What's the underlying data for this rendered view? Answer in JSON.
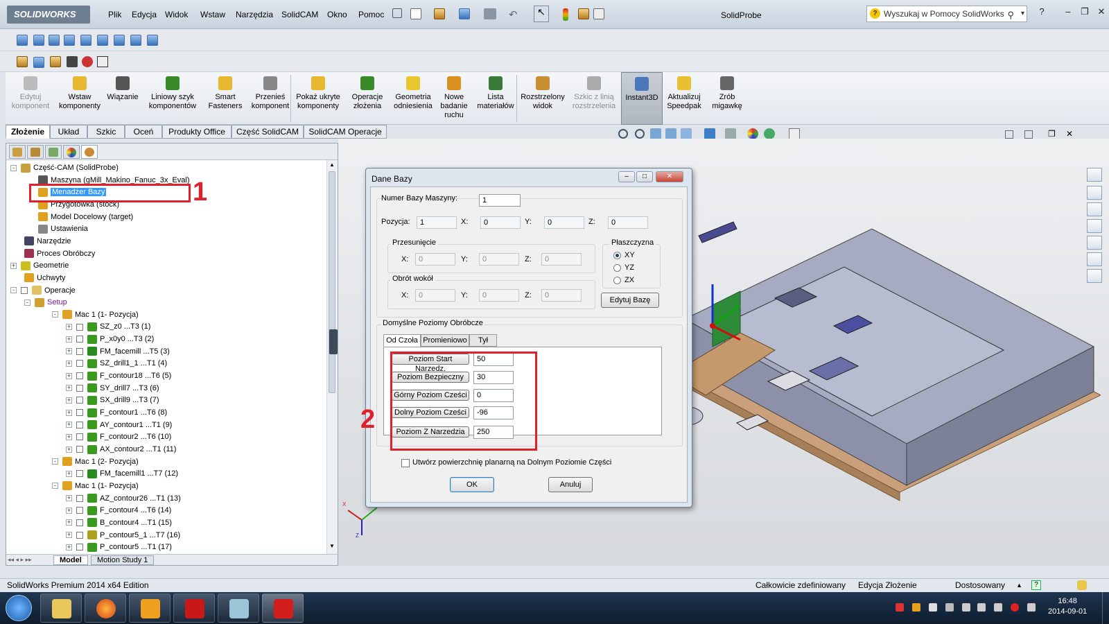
{
  "app": {
    "logo": "SOLIDWORKS",
    "title": "SolidProbe",
    "menu": [
      "Plik",
      "Edycja",
      "Widok",
      "Wstaw",
      "Narzędzia",
      "SolidCAM",
      "Okno",
      "Pomoc"
    ],
    "help_search_placeholder": "Wyszukaj w Pomocy SolidWorks",
    "help_btn": "?"
  },
  "command_manager": [
    {
      "label": "Edytuj komponent",
      "disabled": true,
      "icon": "edit-component-icon"
    },
    {
      "label": "Wstaw komponenty",
      "disabled": false,
      "icon": "insert-components-icon"
    },
    {
      "label": "Wiązanie",
      "disabled": false,
      "icon": "mate-icon"
    },
    {
      "label": "Liniowy szyk komponentów",
      "disabled": false,
      "icon": "linear-pattern-icon"
    },
    {
      "label": "Smart Fasteners",
      "disabled": false,
      "icon": "smart-fasteners-icon"
    },
    {
      "label": "Przenieś komponent",
      "disabled": false,
      "icon": "move-component-icon"
    },
    {
      "label": "Pokaż ukryte komponenty",
      "disabled": false,
      "icon": "show-hidden-icon"
    },
    {
      "label": "Operacje złożenia",
      "disabled": false,
      "icon": "assembly-features-icon"
    },
    {
      "label": "Geometria odniesienia",
      "disabled": false,
      "icon": "reference-geometry-icon"
    },
    {
      "label": "Nowe badanie ruchu",
      "disabled": false,
      "icon": "motion-study-icon"
    },
    {
      "label": "Lista materiałów",
      "disabled": false,
      "icon": "bom-icon"
    },
    {
      "label": "Rozstrzelony widok",
      "disabled": false,
      "icon": "exploded-view-icon"
    },
    {
      "label": "Szkic z linią rozstrzelenia",
      "disabled": true,
      "icon": "explode-line-icon"
    },
    {
      "label": "Instant3D",
      "disabled": false,
      "selected": true,
      "icon": "instant3d-icon"
    },
    {
      "label": "Aktualizuj Speedpak",
      "disabled": false,
      "icon": "speedpak-icon"
    },
    {
      "label": "Zrób migawkę",
      "disabled": false,
      "icon": "snapshot-icon"
    }
  ],
  "tabs": [
    "Złożenie",
    "Układ",
    "Szkic",
    "Oceń",
    "Produkty Office",
    "Część SolidCAM",
    "SolidCAM Operacje"
  ],
  "tree": [
    {
      "text": "Część-CAM (SolidProbe)",
      "level": 0,
      "pm": "-",
      "icon": "cam-part-icon",
      "color": "#c9a040"
    },
    {
      "text": "Maszyna (gMill_Makino_Fanuc_3x_Eval)",
      "level": 2,
      "icon": "machine-icon",
      "color": "#555"
    },
    {
      "text": "Menadżer Bazy",
      "level": 2,
      "icon": "coordinate-manager-icon",
      "color": "#e0a020",
      "highlight": true
    },
    {
      "text": "Przygotówka (stock)",
      "level": 2,
      "icon": "stock-icon",
      "color": "#e0a020"
    },
    {
      "text": "Model Docelowy (target)",
      "level": 2,
      "icon": "target-icon",
      "color": "#e0a020"
    },
    {
      "text": "Ustawienia",
      "level": 2,
      "icon": "settings-icon",
      "color": "#888"
    },
    {
      "text": "Narzędzie",
      "level": 1,
      "icon": "tool-icon",
      "color": "#446"
    },
    {
      "text": "Proces Obróbczy",
      "level": 1,
      "icon": "process-icon",
      "color": "#a03050"
    },
    {
      "text": "Geometrie",
      "level": 0,
      "pm": "+",
      "icon": "geometry-icon",
      "color": "#c9c020"
    },
    {
      "text": "Uchwyty",
      "level": 1,
      "icon": "fixture-icon",
      "color": "#e0a020"
    },
    {
      "text": "Operacje",
      "level": 0,
      "pm": "-",
      "cb": true,
      "icon": "operations-folder-icon",
      "color": "#e0c060"
    },
    {
      "text": "Setup",
      "level": 1,
      "pm": "-",
      "icon": "setup-icon",
      "color": "#d0a030",
      "purple": true
    },
    {
      "text": "Mac 1 (1- Pozycja)",
      "level": 3,
      "pm": "-",
      "icon": "mac-icon",
      "color": "#e0a020"
    },
    {
      "text": "SZ_z0 ...T3 (1)",
      "level": 4,
      "pm": "+",
      "cb": true,
      "icon": "operation-icon",
      "color": "#3a9a20"
    },
    {
      "text": "P_x0y0 ...T3 (2)",
      "level": 4,
      "pm": "+",
      "cb": true,
      "icon": "operation-icon",
      "color": "#3a9a20"
    },
    {
      "text": "FM_facemill ...T5 (3)",
      "level": 4,
      "pm": "+",
      "cb": true,
      "icon": "facemill-icon",
      "color": "#2a8a20"
    },
    {
      "text": "SZ_drill1_1 ...T1 (4)",
      "level": 4,
      "pm": "+",
      "cb": true,
      "icon": "operation-icon",
      "color": "#3a9a20"
    },
    {
      "text": "F_contour18 ...T6 (5)",
      "level": 4,
      "pm": "+",
      "cb": true,
      "icon": "contour-icon",
      "color": "#3a9a20"
    },
    {
      "text": "SY_drill7 ...T3 (6)",
      "level": 4,
      "pm": "+",
      "cb": true,
      "icon": "operation-icon",
      "color": "#3a9a20"
    },
    {
      "text": "SX_drill9 ...T3 (7)",
      "level": 4,
      "pm": "+",
      "cb": true,
      "icon": "operation-icon",
      "color": "#3a9a20"
    },
    {
      "text": "F_contour1 ...T6 (8)",
      "level": 4,
      "pm": "+",
      "cb": true,
      "icon": "contour-icon",
      "color": "#3a9a20"
    },
    {
      "text": "AY_contour1 ...T1 (9)",
      "level": 4,
      "pm": "+",
      "cb": true,
      "icon": "operation-icon",
      "color": "#3a9a20"
    },
    {
      "text": "F_contour2 ...T6 (10)",
      "level": 4,
      "pm": "+",
      "cb": true,
      "icon": "contour-icon",
      "color": "#3a9a20"
    },
    {
      "text": "AX_contour2 ...T1 (11)",
      "level": 4,
      "pm": "+",
      "cb": true,
      "icon": "operation-icon",
      "color": "#3a9a20"
    },
    {
      "text": "Mac 1 (2- Pozycja)",
      "level": 3,
      "pm": "-",
      "icon": "mac-icon",
      "color": "#e0a020"
    },
    {
      "text": "FM_facemill1 ...T7 (12)",
      "level": 4,
      "pm": "+",
      "cb": true,
      "icon": "facemill-icon",
      "color": "#2a8a20"
    },
    {
      "text": "Mac 1 (1- Pozycja)",
      "level": 3,
      "pm": "-",
      "icon": "mac-icon",
      "color": "#e0a020"
    },
    {
      "text": "AZ_contour26 ...T1 (13)",
      "level": 4,
      "pm": "+",
      "cb": true,
      "icon": "operation-icon",
      "color": "#3a9a20"
    },
    {
      "text": "F_contour4 ...T6 (14)",
      "level": 4,
      "pm": "+",
      "cb": true,
      "icon": "contour-icon",
      "color": "#3a9a20"
    },
    {
      "text": "B_contour4 ...T1 (15)",
      "level": 4,
      "pm": "+",
      "cb": true,
      "icon": "operation-icon",
      "color": "#3a9a20"
    },
    {
      "text": "P_contour5_1 ...T7 (16)",
      "level": 4,
      "pm": "+",
      "cb": true,
      "icon": "pocket-icon",
      "color": "#b0a020"
    },
    {
      "text": "P_contour5 ...T1 (17)",
      "level": 4,
      "pm": "+",
      "cb": true,
      "icon": "operation-icon",
      "color": "#3a9a20"
    }
  ],
  "bottom_tabs": [
    "Model",
    "Motion Study 1"
  ],
  "annotations": {
    "label1": "1",
    "label2": "2"
  },
  "dialog": {
    "title": "Dane Bazy",
    "machine_base_label": "Numer Bazy Maszyny:",
    "machine_base_value": "1",
    "position_label": "Pozycja:",
    "position_value": "1",
    "x_label": "X:",
    "y_label": "Y:",
    "z_label": "Z:",
    "pos_x": "0",
    "pos_y": "0",
    "pos_z": "0",
    "shift_title": "Przesunięcie",
    "shift_x": "0",
    "shift_y": "0",
    "shift_z": "0",
    "rotate_title": "Obrót wokół",
    "rot_x": "0",
    "rot_y": "0",
    "rot_z": "0",
    "plane_title": "Płaszczyzna",
    "planes": [
      {
        "label": "XY",
        "selected": true
      },
      {
        "label": "YZ",
        "selected": false
      },
      {
        "label": "ZX",
        "selected": false
      }
    ],
    "edit_base_btn": "Edytuj Bazę",
    "levels_title": "Domyślne Poziomy Obróbcze",
    "level_tabs": [
      "Od Czoła",
      "Promieniowo",
      "Tył"
    ],
    "levels": [
      {
        "label": "Poziom Start Narzedz.",
        "value": "50"
      },
      {
        "label": "Poziom Bezpieczny",
        "value": "30"
      },
      {
        "label": "Górny Poziom Cześci",
        "value": "0"
      },
      {
        "label": "Dolny Poziom Cześci",
        "value": "-96"
      },
      {
        "label": "Poziom  Z Narzedzia",
        "value": "250"
      }
    ],
    "planar_checkbox": "Utwórz powierzchnię planarną na Dolnym Poziomie Części",
    "ok": "OK",
    "cancel": "Anuluj"
  },
  "statusbar": {
    "edition": "SolidWorks Premium 2014 x64 Edition",
    "defined": "Całkowicie zdefiniowany",
    "editing": "Edycja Złożenie",
    "custom": "Dostosowany"
  },
  "taskbar": {
    "time": "16:48",
    "date": "2014-09-01"
  },
  "triad_labels": {
    "x": "X",
    "y": "Y",
    "z": "Z"
  }
}
